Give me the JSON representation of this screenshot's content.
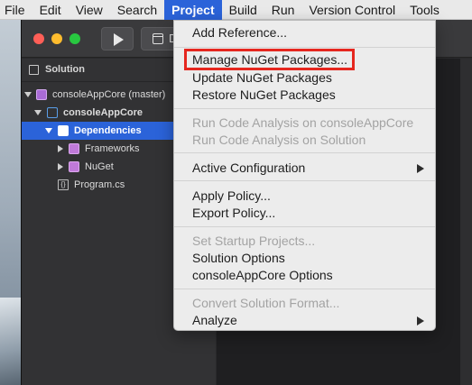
{
  "menubar": {
    "items": [
      "File",
      "Edit",
      "View",
      "Search",
      "Project",
      "Build",
      "Run",
      "Version Control",
      "Tools"
    ],
    "active": "Project",
    "active_color": "#2b63d9"
  },
  "toolbar": {
    "play_icon": "play-icon",
    "config_text": "D"
  },
  "pad": {
    "title": "Solution",
    "tree": [
      {
        "label": "consoleAppCore (master)",
        "icon": "solution-icon",
        "expanded": true
      },
      {
        "label": "consoleAppCore",
        "icon": "project-icon",
        "expanded": true
      },
      {
        "label": "Dependencies",
        "icon": "folder-icon",
        "expanded": true,
        "selected": true
      },
      {
        "label": "Frameworks",
        "icon": "folder-icon",
        "expanded": false
      },
      {
        "label": "NuGet",
        "icon": "folder-icon",
        "expanded": false
      },
      {
        "label": "Program.cs",
        "icon": "csharp-file-icon"
      }
    ],
    "selection_color": "#2b63d9"
  },
  "project_menu": {
    "items": [
      {
        "label": "Add Reference...",
        "enabled": true
      },
      {
        "label": "Manage NuGet Packages...",
        "enabled": true,
        "highlighted": true
      },
      {
        "label": "Update NuGet Packages",
        "enabled": true
      },
      {
        "label": "Restore NuGet Packages",
        "enabled": true
      },
      {
        "label": "Run Code Analysis on consoleAppCore",
        "enabled": false
      },
      {
        "label": "Run Code Analysis on Solution",
        "enabled": false
      },
      {
        "label": "Active Configuration",
        "enabled": true,
        "submenu": true
      },
      {
        "label": "Apply Policy...",
        "enabled": true
      },
      {
        "label": "Export Policy...",
        "enabled": true
      },
      {
        "label": "Set Startup Projects...",
        "enabled": false
      },
      {
        "label": "Solution Options",
        "enabled": true
      },
      {
        "label": "consoleAppCore Options",
        "enabled": true
      },
      {
        "label": "Convert Solution Format...",
        "enabled": false
      },
      {
        "label": "Analyze",
        "enabled": true,
        "submenu": true
      }
    ],
    "highlight_color": "#e5271f"
  }
}
